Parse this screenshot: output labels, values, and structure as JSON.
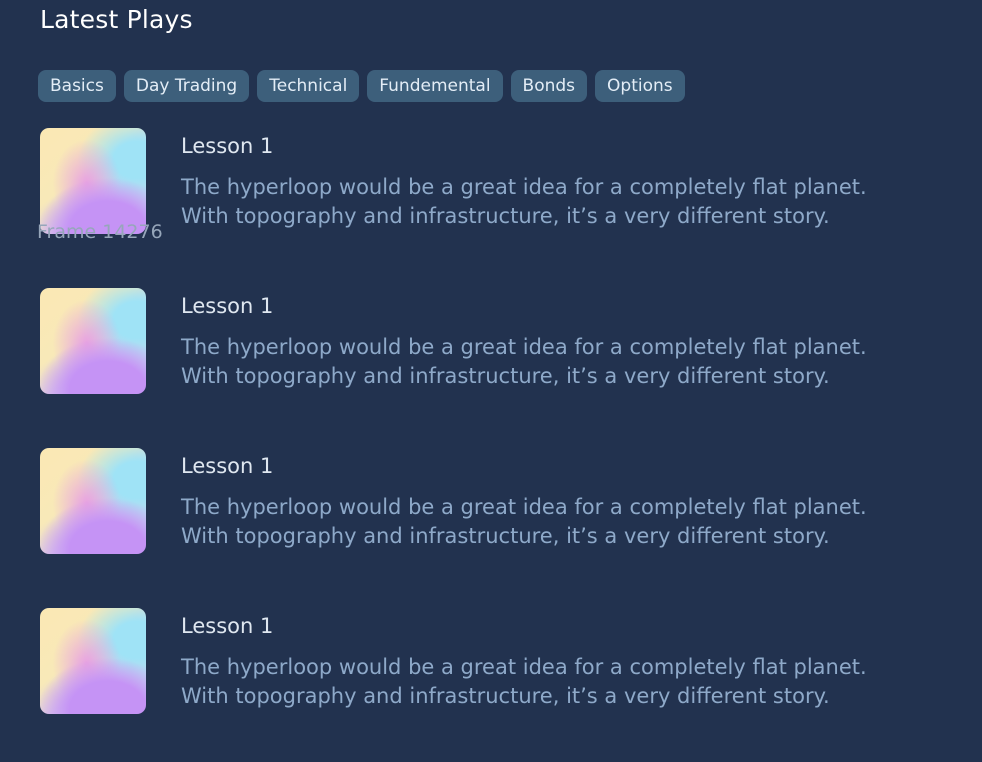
{
  "header": {
    "title": "Latest Plays"
  },
  "filters": {
    "chips": [
      {
        "label": "Basics"
      },
      {
        "label": "Day Trading"
      },
      {
        "label": "Technical"
      },
      {
        "label": "Fundemental"
      },
      {
        "label": "Bonds"
      },
      {
        "label": "Options"
      }
    ]
  },
  "lessons": [
    {
      "title": "Lesson 1",
      "description": "The hyperloop would be a great idea for a completely flat planet. With topography and infrastructure, it’s a very different story.",
      "thumb_caption": "Frame 14276"
    },
    {
      "title": "Lesson 1",
      "description": "The hyperloop would be a great idea for a completely flat planet. With topography and infrastructure, it’s a very different story."
    },
    {
      "title": "Lesson 1",
      "description": "The hyperloop would be a great idea for a completely flat planet. With topography and infrastructure, it’s a very different story."
    },
    {
      "title": "Lesson 1",
      "description": "The hyperloop would be a great idea for a completely flat planet. With topography and infrastructure, it’s a very different story."
    }
  ],
  "colors": {
    "background": "#22324f",
    "chip_background": "#3d5f7b",
    "title_text": "#ffffff",
    "lesson_title_text": "#dfe7f0",
    "description_text": "#8ea9c9"
  }
}
